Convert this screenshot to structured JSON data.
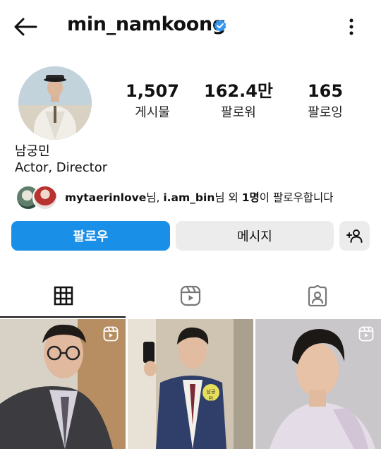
{
  "header": {
    "username": "min_namkoong",
    "back_icon": "arrow-left-icon",
    "more_icon": "more-vertical-icon",
    "verified_color": "#3897f0"
  },
  "profile": {
    "stats": [
      {
        "value": "1,507",
        "label": "게시물"
      },
      {
        "value": "162.4만",
        "label": "팔로워"
      },
      {
        "value": "165",
        "label": "팔로잉"
      }
    ],
    "name": "남궁민",
    "bio": "Actor, Director",
    "followed_by": {
      "user1": "mytaerinlove",
      "sep1": "님, ",
      "user2": "i.am_bin",
      "sep2": "님 외 ",
      "count": "1명",
      "suffix": "이 팔로우합니다"
    }
  },
  "actions": {
    "follow_label": "팔로우",
    "message_label": "메시지",
    "suggest_icon": "add-person-icon",
    "follow_color": "#1a8fe8"
  },
  "tabs": [
    {
      "icon": "grid-icon",
      "active": true
    },
    {
      "icon": "reels-icon",
      "active": false
    },
    {
      "icon": "tagged-icon",
      "active": false
    }
  ],
  "grid": [
    {
      "icon": "reels-badge-icon"
    },
    {
      "icon": "",
      "badge_text": "남궁민"
    },
    {
      "icon": "reels-badge-icon"
    }
  ]
}
